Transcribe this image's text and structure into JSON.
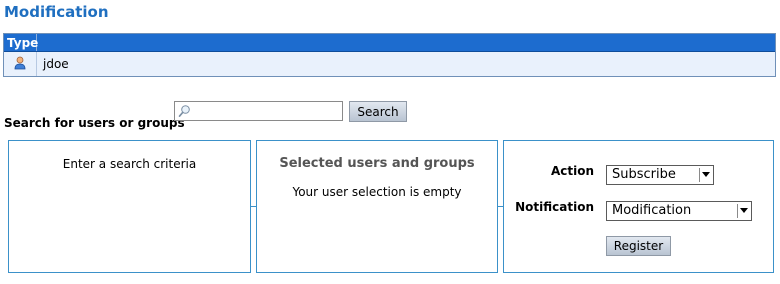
{
  "page": {
    "title": "Modification"
  },
  "subscriptions_table": {
    "header": {
      "type_label": "Type"
    },
    "rows": [
      {
        "icon": "user-icon",
        "name": "jdoe"
      }
    ]
  },
  "search": {
    "label": "Search for users or groups",
    "value": "",
    "placeholder": "",
    "button_label": "Search"
  },
  "results_panel": {
    "message": "Enter a search criteria"
  },
  "selection_panel": {
    "title": "Selected users and groups",
    "message": "Your user selection is empty"
  },
  "action_panel": {
    "action_label": "Action",
    "action_value": "Subscribe",
    "notification_label": "Notification",
    "notification_value": "Modification",
    "register_label": "Register"
  },
  "colors": {
    "title": "#1f6fc0",
    "table_header": "#1d6ccf",
    "table_row": "#e9f1fc",
    "panel_border": "#3b91c9"
  }
}
